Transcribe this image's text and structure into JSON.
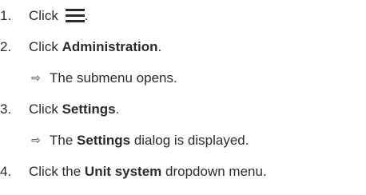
{
  "steps": [
    {
      "number": "1.",
      "prefix": "Click",
      "suffix": "."
    },
    {
      "number": "2.",
      "prefix": "Click",
      "bold": "Administration",
      "suffix": "."
    },
    {
      "result": "The submenu opens."
    },
    {
      "number": "3.",
      "prefix": "Click",
      "bold": "Settings",
      "suffix": "."
    },
    {
      "result_prefix": "The",
      "result_bold": "Settings",
      "result_suffix": "dialog is displayed."
    },
    {
      "number": "4.",
      "prefix": "Click the",
      "bold": "Unit system",
      "suffix": "dropdown menu."
    }
  ],
  "icons": {
    "menu": "hamburger-menu-icon",
    "result_arrow": "right-arrow-outline-icon"
  }
}
